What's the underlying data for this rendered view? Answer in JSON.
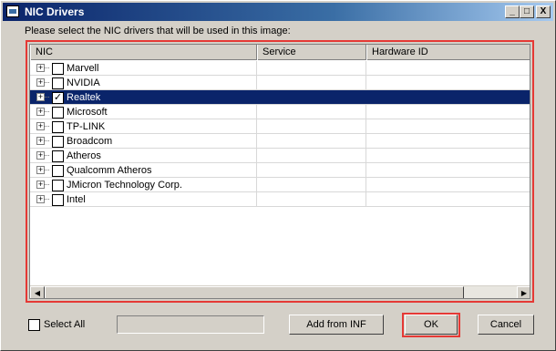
{
  "window": {
    "title": "NIC Drivers",
    "minimize": "_",
    "maximize": "□",
    "close": "X"
  },
  "prompt": "Please select the NIC drivers that will be used in this image:",
  "table": {
    "columns": [
      "NIC",
      "Service",
      "Hardware ID"
    ],
    "rows": [
      {
        "label": "Marvell",
        "checked": false,
        "selected": false
      },
      {
        "label": "NVIDIA",
        "checked": false,
        "selected": false
      },
      {
        "label": "Realtek",
        "checked": true,
        "selected": true
      },
      {
        "label": "Microsoft",
        "checked": false,
        "selected": false
      },
      {
        "label": "TP-LINK",
        "checked": false,
        "selected": false
      },
      {
        "label": "Broadcom",
        "checked": false,
        "selected": false
      },
      {
        "label": "Atheros",
        "checked": false,
        "selected": false
      },
      {
        "label": "Qualcomm Atheros",
        "checked": false,
        "selected": false
      },
      {
        "label": "JMicron Technology Corp.",
        "checked": false,
        "selected": false
      },
      {
        "label": "Intel",
        "checked": false,
        "selected": false
      }
    ],
    "expander": "+"
  },
  "footer": {
    "select_all_label": "Select All",
    "add_from_inf_label": "Add from INF",
    "ok_label": "OK",
    "cancel_label": "Cancel"
  },
  "colors": {
    "highlight": "#e53935",
    "selection": "#0a246a"
  }
}
